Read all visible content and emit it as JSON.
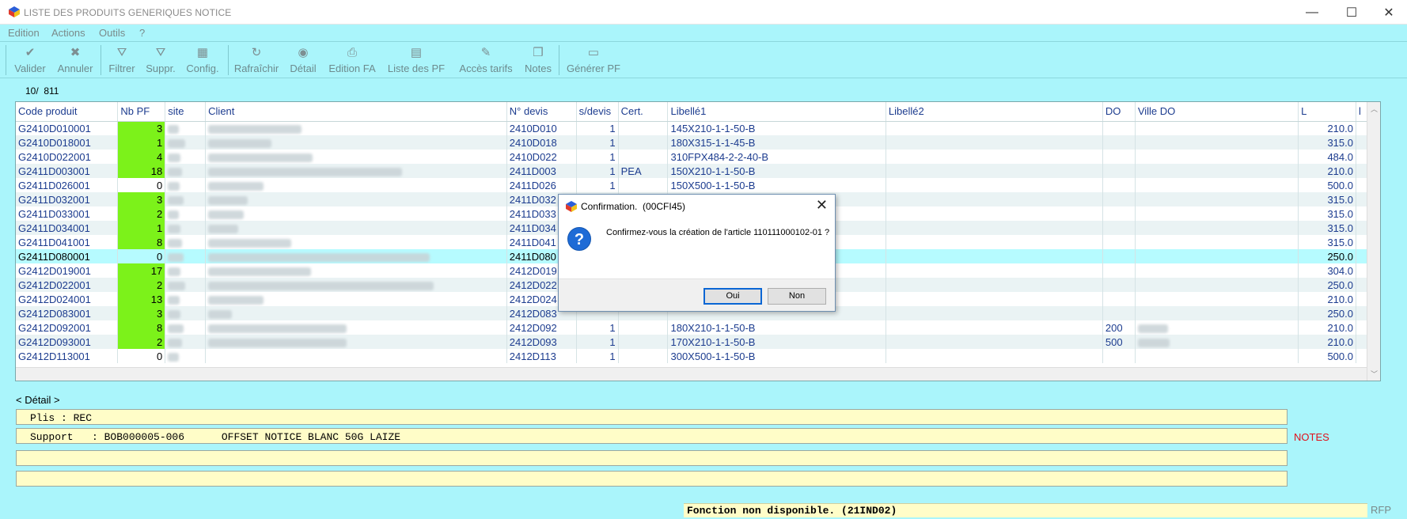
{
  "window": {
    "title": "LISTE DES PRODUITS GENERIQUES NOTICE",
    "minimize": "—",
    "maximize": "☐",
    "close": "✕"
  },
  "menu": [
    "Edition",
    "Actions",
    "Outils",
    "?"
  ],
  "toolbar": [
    {
      "label": "Valider",
      "icon": "check-icon",
      "glyph": "✔"
    },
    {
      "label": "Annuler",
      "icon": "cross-icon",
      "glyph": "✖"
    },
    {
      "label": "Filtrer",
      "icon": "filter-icon",
      "glyph": "⛛"
    },
    {
      "label": "Suppr.",
      "icon": "filter-remove-icon",
      "glyph": "⛛"
    },
    {
      "label": "Config.",
      "icon": "table-config-icon",
      "glyph": "▦"
    },
    {
      "label": "Rafraîchir",
      "icon": "refresh-icon",
      "glyph": "↻"
    },
    {
      "label": "Détail",
      "icon": "detail-icon",
      "glyph": "◉"
    },
    {
      "label": "Edition FA",
      "icon": "printer-icon",
      "glyph": "⎙"
    },
    {
      "label": "Liste des PF",
      "icon": "list-icon",
      "glyph": "▤"
    },
    {
      "label": "Accès tarifs",
      "icon": "tarifs-icon",
      "glyph": "✎"
    },
    {
      "label": "Notes",
      "icon": "notes-icon",
      "glyph": "❒"
    },
    {
      "label": "Générer PF",
      "icon": "generate-icon",
      "glyph": "▭"
    }
  ],
  "counter": "10/  811",
  "grid": {
    "columns": [
      "Code produit",
      "Nb PF",
      "site",
      "Client",
      "N° devis",
      "s/devis",
      "Cert.",
      "Libellé1",
      "Libellé2",
      "DO",
      "Ville DO",
      "L",
      "l"
    ],
    "rows": [
      {
        "code": "G2410D010001",
        "nb": "3",
        "green": true,
        "devis": "2410D010",
        "sdevis": "1",
        "cert": "",
        "lib1": "145X210-1-1-50-B",
        "do": "",
        "L": "210.0"
      },
      {
        "code": "G2410D018001",
        "nb": "1",
        "green": true,
        "devis": "2410D018",
        "sdevis": "1",
        "cert": "",
        "lib1": "180X315-1-1-45-B",
        "do": "",
        "L": "315.0"
      },
      {
        "code": "G2410D022001",
        "nb": "4",
        "green": true,
        "devis": "2410D022",
        "sdevis": "1",
        "cert": "",
        "lib1": "310FPX484-2-2-40-B",
        "do": "",
        "L": "484.0"
      },
      {
        "code": "G2411D003001",
        "nb": "18",
        "green": true,
        "devis": "2411D003",
        "sdevis": "1",
        "cert": "PEA",
        "lib1": "150X210-1-1-50-B",
        "do": "",
        "L": "210.0"
      },
      {
        "code": "G2411D026001",
        "nb": "0",
        "green": false,
        "devis": "2411D026",
        "sdevis": "1",
        "cert": "",
        "lib1": "150X500-1-1-50-B",
        "do": "",
        "L": "500.0"
      },
      {
        "code": "G2411D032001",
        "nb": "3",
        "green": true,
        "devis": "2411D032",
        "sdevis": "",
        "cert": "",
        "lib1": "",
        "do": "",
        "L": "315.0"
      },
      {
        "code": "G2411D033001",
        "nb": "2",
        "green": true,
        "devis": "2411D033",
        "sdevis": "",
        "cert": "",
        "lib1": "",
        "do": "",
        "L": "315.0"
      },
      {
        "code": "G2411D034001",
        "nb": "1",
        "green": true,
        "devis": "2411D034",
        "sdevis": "",
        "cert": "",
        "lib1": "",
        "do": "",
        "L": "315.0"
      },
      {
        "code": "G2411D041001",
        "nb": "8",
        "green": true,
        "devis": "2411D041",
        "sdevis": "",
        "cert": "",
        "lib1": "",
        "do": "",
        "L": "315.0"
      },
      {
        "code": "G2411D080001",
        "nb": "0",
        "green": false,
        "devis": "2411D080",
        "sdevis": "",
        "cert": "",
        "lib1": "",
        "do": "",
        "L": "250.0",
        "selected": true
      },
      {
        "code": "G2412D019001",
        "nb": "17",
        "green": true,
        "devis": "2412D019",
        "sdevis": "",
        "cert": "",
        "lib1": "",
        "do": "",
        "L": "304.0"
      },
      {
        "code": "G2412D022001",
        "nb": "2",
        "green": true,
        "devis": "2412D022",
        "sdevis": "",
        "cert": "",
        "lib1": "",
        "do": "",
        "L": "250.0"
      },
      {
        "code": "G2412D024001",
        "nb": "13",
        "green": true,
        "devis": "2412D024",
        "sdevis": "",
        "cert": "",
        "lib1": "",
        "do": "",
        "L": "210.0"
      },
      {
        "code": "G2412D083001",
        "nb": "3",
        "green": true,
        "devis": "2412D083",
        "sdevis": "",
        "cert": "",
        "lib1": "",
        "do": "",
        "L": "250.0"
      },
      {
        "code": "G2412D092001",
        "nb": "8",
        "green": true,
        "devis": "2412D092",
        "sdevis": "1",
        "cert": "",
        "lib1": "180X210-1-1-50-B",
        "do": "200",
        "L": "210.0"
      },
      {
        "code": "G2412D093001",
        "nb": "2",
        "green": true,
        "devis": "2412D093",
        "sdevis": "1",
        "cert": "",
        "lib1": "170X210-1-1-50-B",
        "do": "500",
        "L": "210.0"
      },
      {
        "code": "G2412D113001",
        "nb": "0",
        "green": false,
        "devis": "2412D113",
        "sdevis": "1",
        "cert": "",
        "lib1": "300X500-1-1-50-B",
        "do": "",
        "L": "500.0"
      }
    ]
  },
  "detail": {
    "title": "< Détail >",
    "line1": "Plis : REC",
    "line2": "Support   : BOB000005-006      OFFSET NOTICE BLANC 50G LAIZE",
    "line3": "",
    "line4": "",
    "notes": "NOTES"
  },
  "status": {
    "message": "Fonction non disponible. (21IND02)",
    "code": "RFP"
  },
  "dialog": {
    "title": "Confirmation.  (00CFI45)",
    "message": "Confirmez-vous la création de l'article 110111000102-01 ?",
    "ok": "Oui",
    "cancel": "Non"
  },
  "colors": {
    "background": "#aaf5fb",
    "green_cell": "#7cf21a",
    "detail_bg": "#fffdc8",
    "notes": "#e0101a"
  }
}
